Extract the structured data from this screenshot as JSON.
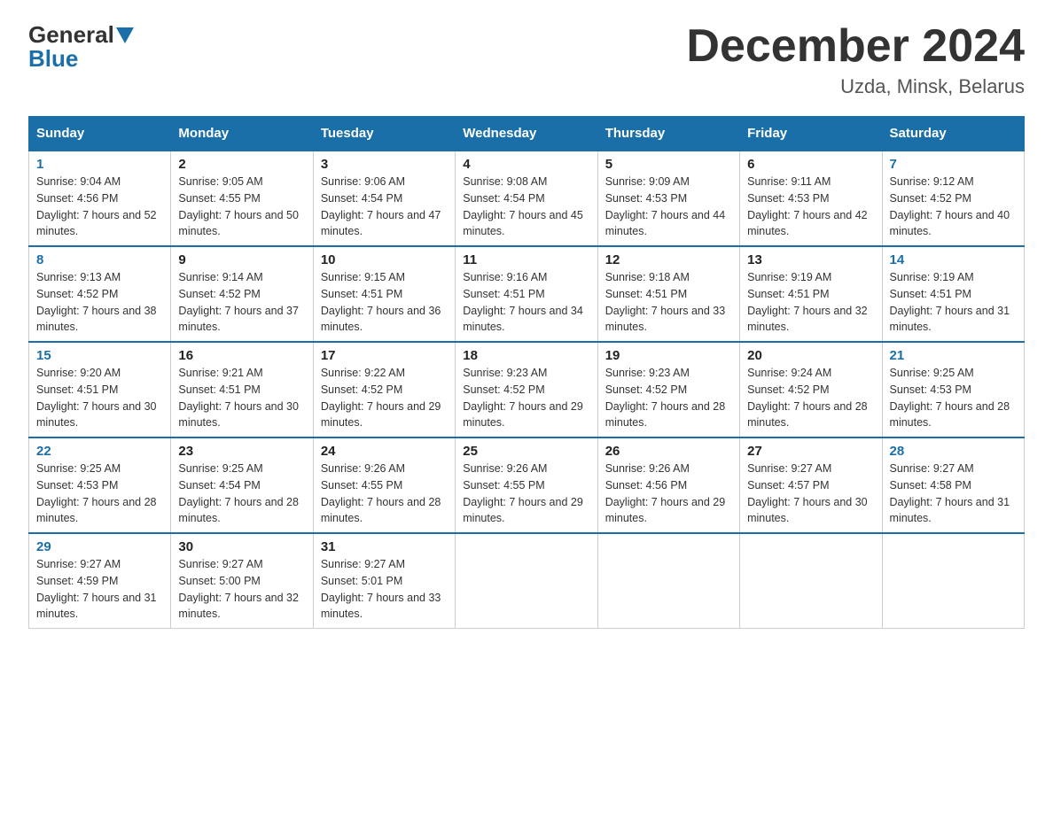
{
  "header": {
    "logo_text1": "General",
    "logo_text2": "Blue",
    "month": "December 2024",
    "location": "Uzda, Minsk, Belarus"
  },
  "days_of_week": [
    "Sunday",
    "Monday",
    "Tuesday",
    "Wednesday",
    "Thursday",
    "Friday",
    "Saturday"
  ],
  "weeks": [
    [
      {
        "num": "1",
        "sunrise": "9:04 AM",
        "sunset": "4:56 PM",
        "daylight": "7 hours and 52 minutes."
      },
      {
        "num": "2",
        "sunrise": "9:05 AM",
        "sunset": "4:55 PM",
        "daylight": "7 hours and 50 minutes."
      },
      {
        "num": "3",
        "sunrise": "9:06 AM",
        "sunset": "4:54 PM",
        "daylight": "7 hours and 47 minutes."
      },
      {
        "num": "4",
        "sunrise": "9:08 AM",
        "sunset": "4:54 PM",
        "daylight": "7 hours and 45 minutes."
      },
      {
        "num": "5",
        "sunrise": "9:09 AM",
        "sunset": "4:53 PM",
        "daylight": "7 hours and 44 minutes."
      },
      {
        "num": "6",
        "sunrise": "9:11 AM",
        "sunset": "4:53 PM",
        "daylight": "7 hours and 42 minutes."
      },
      {
        "num": "7",
        "sunrise": "9:12 AM",
        "sunset": "4:52 PM",
        "daylight": "7 hours and 40 minutes."
      }
    ],
    [
      {
        "num": "8",
        "sunrise": "9:13 AM",
        "sunset": "4:52 PM",
        "daylight": "7 hours and 38 minutes."
      },
      {
        "num": "9",
        "sunrise": "9:14 AM",
        "sunset": "4:52 PM",
        "daylight": "7 hours and 37 minutes."
      },
      {
        "num": "10",
        "sunrise": "9:15 AM",
        "sunset": "4:51 PM",
        "daylight": "7 hours and 36 minutes."
      },
      {
        "num": "11",
        "sunrise": "9:16 AM",
        "sunset": "4:51 PM",
        "daylight": "7 hours and 34 minutes."
      },
      {
        "num": "12",
        "sunrise": "9:18 AM",
        "sunset": "4:51 PM",
        "daylight": "7 hours and 33 minutes."
      },
      {
        "num": "13",
        "sunrise": "9:19 AM",
        "sunset": "4:51 PM",
        "daylight": "7 hours and 32 minutes."
      },
      {
        "num": "14",
        "sunrise": "9:19 AM",
        "sunset": "4:51 PM",
        "daylight": "7 hours and 31 minutes."
      }
    ],
    [
      {
        "num": "15",
        "sunrise": "9:20 AM",
        "sunset": "4:51 PM",
        "daylight": "7 hours and 30 minutes."
      },
      {
        "num": "16",
        "sunrise": "9:21 AM",
        "sunset": "4:51 PM",
        "daylight": "7 hours and 30 minutes."
      },
      {
        "num": "17",
        "sunrise": "9:22 AM",
        "sunset": "4:52 PM",
        "daylight": "7 hours and 29 minutes."
      },
      {
        "num": "18",
        "sunrise": "9:23 AM",
        "sunset": "4:52 PM",
        "daylight": "7 hours and 29 minutes."
      },
      {
        "num": "19",
        "sunrise": "9:23 AM",
        "sunset": "4:52 PM",
        "daylight": "7 hours and 28 minutes."
      },
      {
        "num": "20",
        "sunrise": "9:24 AM",
        "sunset": "4:52 PM",
        "daylight": "7 hours and 28 minutes."
      },
      {
        "num": "21",
        "sunrise": "9:25 AM",
        "sunset": "4:53 PM",
        "daylight": "7 hours and 28 minutes."
      }
    ],
    [
      {
        "num": "22",
        "sunrise": "9:25 AM",
        "sunset": "4:53 PM",
        "daylight": "7 hours and 28 minutes."
      },
      {
        "num": "23",
        "sunrise": "9:25 AM",
        "sunset": "4:54 PM",
        "daylight": "7 hours and 28 minutes."
      },
      {
        "num": "24",
        "sunrise": "9:26 AM",
        "sunset": "4:55 PM",
        "daylight": "7 hours and 28 minutes."
      },
      {
        "num": "25",
        "sunrise": "9:26 AM",
        "sunset": "4:55 PM",
        "daylight": "7 hours and 29 minutes."
      },
      {
        "num": "26",
        "sunrise": "9:26 AM",
        "sunset": "4:56 PM",
        "daylight": "7 hours and 29 minutes."
      },
      {
        "num": "27",
        "sunrise": "9:27 AM",
        "sunset": "4:57 PM",
        "daylight": "7 hours and 30 minutes."
      },
      {
        "num": "28",
        "sunrise": "9:27 AM",
        "sunset": "4:58 PM",
        "daylight": "7 hours and 31 minutes."
      }
    ],
    [
      {
        "num": "29",
        "sunrise": "9:27 AM",
        "sunset": "4:59 PM",
        "daylight": "7 hours and 31 minutes."
      },
      {
        "num": "30",
        "sunrise": "9:27 AM",
        "sunset": "5:00 PM",
        "daylight": "7 hours and 32 minutes."
      },
      {
        "num": "31",
        "sunrise": "9:27 AM",
        "sunset": "5:01 PM",
        "daylight": "7 hours and 33 minutes."
      },
      null,
      null,
      null,
      null
    ]
  ]
}
